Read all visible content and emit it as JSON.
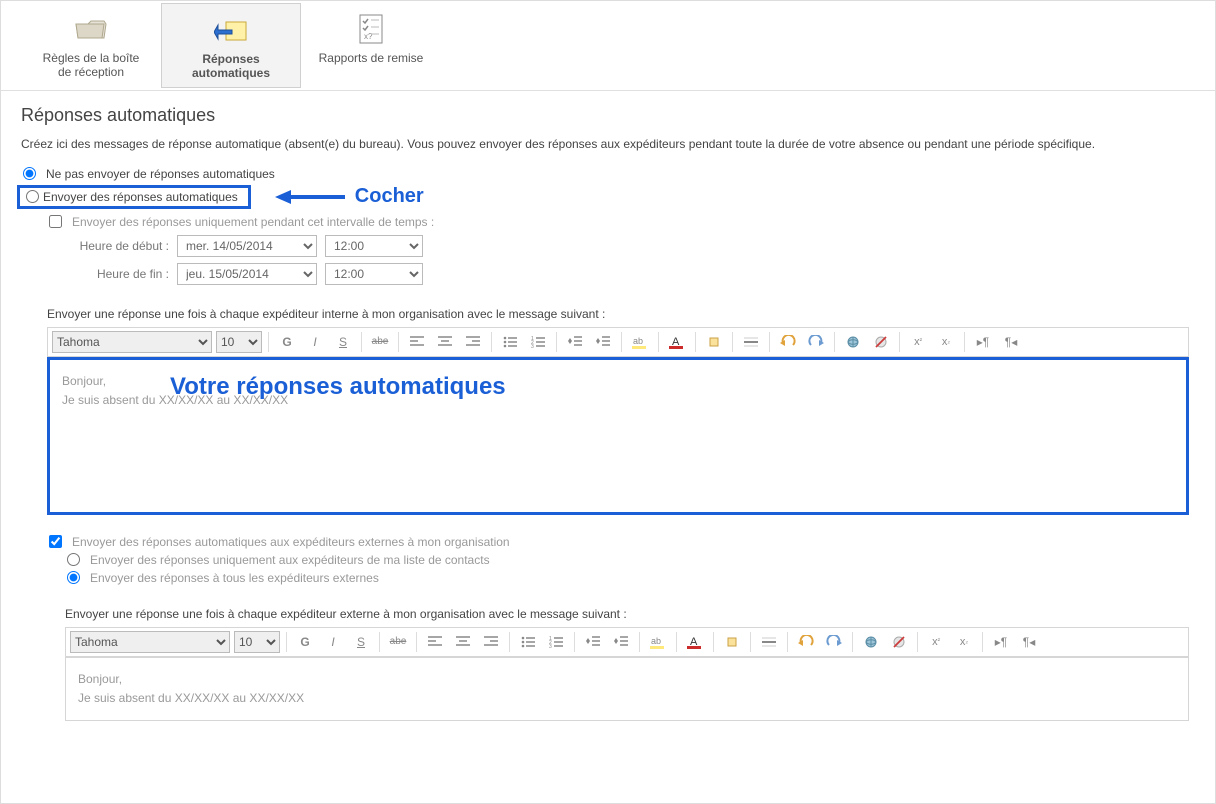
{
  "ribbon": {
    "inbox_rules": "Règles de la boîte de réception",
    "auto_replies": "Réponses automatiques",
    "delivery_reports": "Rapports de remise"
  },
  "page": {
    "title": "Réponses automatiques",
    "description": "Créez ici des messages de réponse automatique (absent(e) du bureau). Vous pouvez envoyer des réponses aux expéditeurs pendant toute la durée de votre absence ou pendant une période spécifique."
  },
  "options": {
    "no_send": "Ne pas envoyer de réponses automatiques",
    "send": "Envoyer des réponses automatiques",
    "send_period_only": "Envoyer des réponses uniquement pendant cet intervalle de temps :",
    "start_label": "Heure de début :",
    "start_date": "mer. 14/05/2014",
    "start_time": "12:00",
    "end_label": "Heure de fin :",
    "end_date": "jeu. 15/05/2014",
    "end_time": "12:00"
  },
  "annotations": {
    "cocher": "Cocher",
    "votre_reponses": "Votre réponses automatiques"
  },
  "internal": {
    "label": "Envoyer une réponse une fois à chaque expéditeur interne à mon organisation avec le message suivant :",
    "font": "Tahoma",
    "size": "10",
    "body_line1": "Bonjour,",
    "body_line2": "Je suis absent du XX/XX/XX au XX/XX/XX"
  },
  "external": {
    "enable": "Envoyer des réponses automatiques aux expéditeurs externes à mon organisation",
    "contacts_only": "Envoyer des réponses uniquement aux expéditeurs de ma liste de contacts",
    "all_external": "Envoyer des réponses à tous les expéditeurs externes",
    "label": "Envoyer une réponse une fois à chaque expéditeur externe à mon organisation avec le message suivant :",
    "font": "Tahoma",
    "size": "10",
    "body_line1": "Bonjour,",
    "body_line2": "Je suis absent du XX/XX/XX au XX/XX/XX"
  }
}
